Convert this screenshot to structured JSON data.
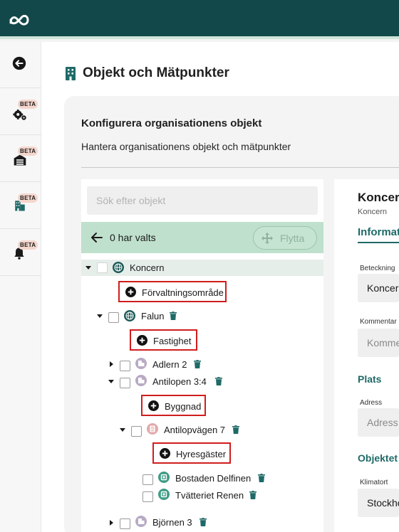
{
  "page_title": "Objekt och Mätpunkter",
  "sidebar": {
    "items": [
      {
        "name": "back",
        "beta": ""
      },
      {
        "name": "settings",
        "beta": "BETA"
      },
      {
        "name": "organisation",
        "beta": "BETA"
      },
      {
        "name": "objects",
        "beta": "BETA"
      },
      {
        "name": "notifications",
        "beta": "BETA"
      }
    ]
  },
  "card": {
    "title": "Konfigurera organisationens objekt",
    "subtitle": "Hantera organisationens objekt och mätpunkter"
  },
  "search": {
    "placeholder": "Sök efter objekt",
    "value": ""
  },
  "selection": {
    "text": "0 har valts",
    "move_label": "Flytta"
  },
  "tree": {
    "koncern": "Koncern",
    "add_forvaltning": "Förvaltningsområde",
    "falun": "Falun",
    "add_fastighet": "Fastighet",
    "adlern": "Adlern 2",
    "antilopen": "Antilopen 3:4",
    "add_byggnad": "Byggnad",
    "antilopvagen": "Antilopvägen 7",
    "add_hyresgaster": "Hyresgäster",
    "bostaden": "Bostaden Delfinen",
    "tvatteriet": "Tvätteriet Renen",
    "bjornen": "Björnen 3"
  },
  "detail": {
    "title": "Koncern",
    "subtitle": "Koncern",
    "tab": "Information",
    "beteckning_label": "Beteckning",
    "beteckning_value": "Koncern",
    "kommentar_label": "Kommentar",
    "kommentar_placeholder": "Kommentar",
    "plats_heading": "Plats",
    "adress_label": "Adress",
    "adress_placeholder": "Adress",
    "objektet_heading": "Objektet",
    "klimatort_label": "Klimatort",
    "klimatort_value": "Stockholm"
  },
  "colors": {
    "topbar": "#13484a",
    "accent": "#1e6a67",
    "selection_bar": "#bfe0cd",
    "highlight_border": "#d01d1d",
    "beta_badge": "#f4d6cc"
  }
}
